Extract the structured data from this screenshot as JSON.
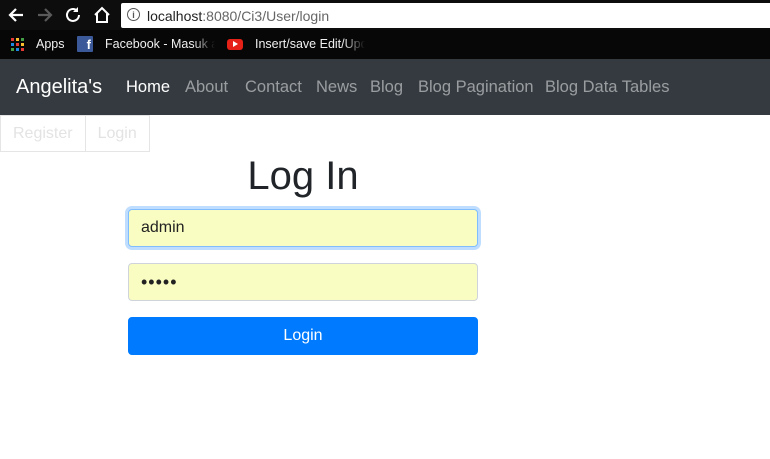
{
  "browser": {
    "url_host": "localhost",
    "url_path": ":8080/Ci3/User/login"
  },
  "bookmarks": {
    "apps": "Apps",
    "facebook": "Facebook - Masuk at",
    "youtube": "Insert/save Edit/Upd"
  },
  "navbar": {
    "brand": "Angelita's",
    "links": [
      "Home",
      "About",
      "Contact",
      "News",
      "Blog",
      "Blog Pagination",
      "Blog Data Tables"
    ],
    "active": "Home"
  },
  "auth_links": {
    "register": "Register",
    "login": "Login"
  },
  "form": {
    "title": "Log In",
    "username_value": "admin",
    "password_value": "•••••",
    "submit_label": "Login"
  },
  "colors": {
    "navbar_bg": "#343a40",
    "primary": "#007bff",
    "autofill": "#fafdc1"
  }
}
